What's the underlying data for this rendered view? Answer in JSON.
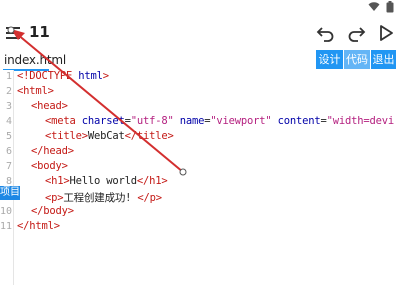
{
  "toolbar": {
    "title": "11",
    "icons": [
      "menu-icon",
      "undo-icon",
      "redo-icon",
      "play-icon"
    ]
  },
  "status_icons": [
    "wifi-icon",
    "battery-icon"
  ],
  "file": {
    "name": "index.html"
  },
  "segments": [
    {
      "label": "设计"
    },
    {
      "label": "代码"
    },
    {
      "label": "退出"
    }
  ],
  "side_tab": {
    "label": "项目"
  },
  "editor": {
    "line_numbers": [
      "1",
      "2",
      "3",
      "4",
      "5",
      "6",
      "7",
      "8",
      "9",
      "10",
      "11"
    ],
    "lines": {
      "l1": {
        "a": "<!DOCTYPE ",
        "b": "html",
        "c": ">"
      },
      "l2": {
        "a": "<html>"
      },
      "l3": {
        "a": "<head>"
      },
      "l4": {
        "a": "<meta ",
        "b": "charset",
        "c": "=",
        "d": "\"utf-8\"",
        "e": " name",
        "f": "=",
        "g": "\"viewport\"",
        "h": " content",
        "i": "=",
        "j": "\"width=devi"
      },
      "l5": {
        "a": "<title>",
        "b": "WebCat",
        "c": "</title>"
      },
      "l6": {
        "a": "</head>"
      },
      "l7": {
        "a": "<body>"
      },
      "l8": {
        "a": "<h1>",
        "b": "Hello world",
        "c": "</h1>"
      },
      "l9": {
        "a": "<p>",
        "b": "工程创建成功!",
        "c": " </p>"
      },
      "l10": {
        "a": "</body>"
      },
      "l11": {
        "a": "</html>"
      }
    }
  },
  "colors": {
    "accent": "#2196f3",
    "segment_active": "#64b5f6",
    "tag": "#c41a16",
    "attr": "#0000a8",
    "value": "#b41f7f",
    "arrow": "#d32f2f"
  }
}
